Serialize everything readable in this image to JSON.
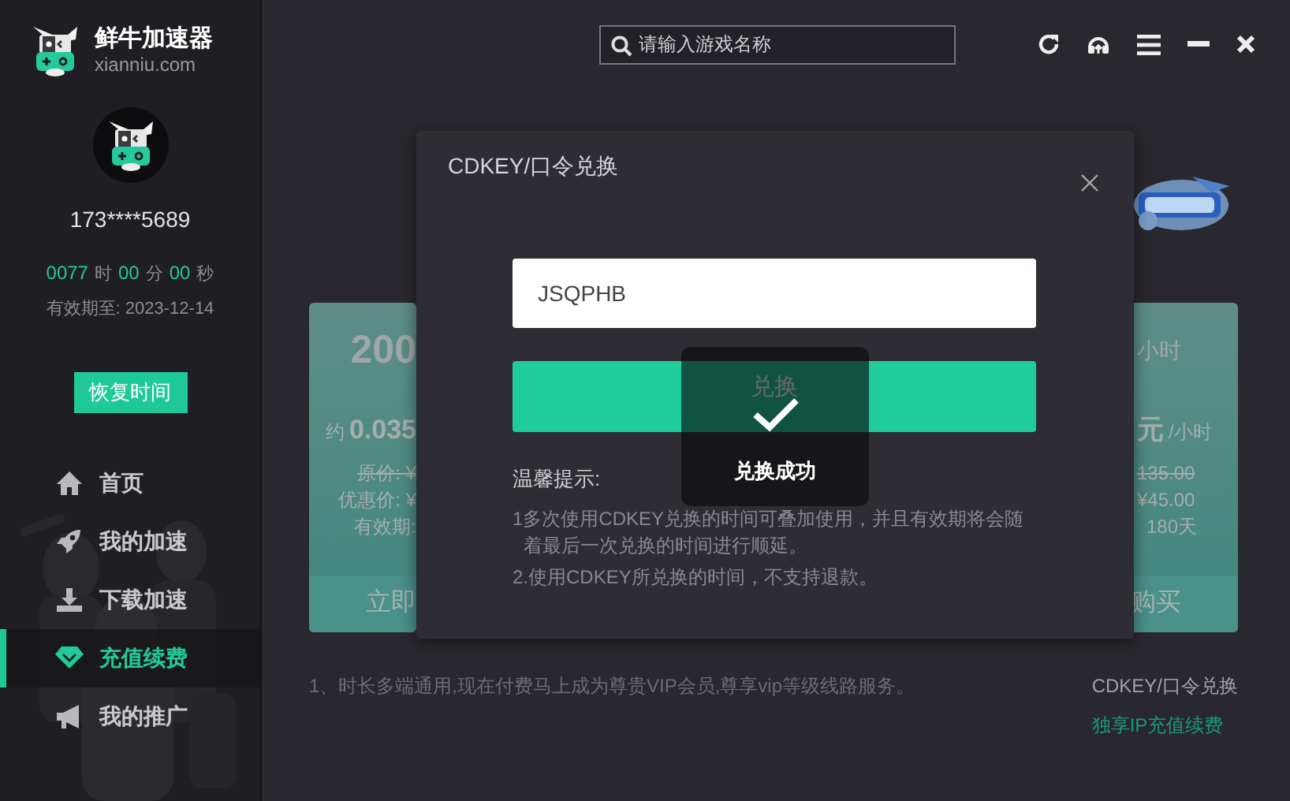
{
  "app": {
    "name": "鲜牛加速器",
    "domain": "xianniu.com"
  },
  "user": {
    "phone": "173****5689",
    "timer": [
      {
        "value": "0077",
        "unit": "时"
      },
      {
        "value": "00",
        "unit": "分"
      },
      {
        "value": "00",
        "unit": "秒"
      }
    ],
    "expiry": "有效期至: 2023-12-14",
    "restore_button": "恢复时间"
  },
  "nav": [
    {
      "label": "首页",
      "selected": false
    },
    {
      "label": "我的加速",
      "selected": false
    },
    {
      "label": "下载加速",
      "selected": false
    },
    {
      "label": "充值续费",
      "selected": true
    },
    {
      "label": "我的推广",
      "selected": false
    }
  ],
  "search": {
    "placeholder": "请输入游戏名称"
  },
  "plans": [
    {
      "amount": "200",
      "price_prefix": "约",
      "price": "0.035",
      "original": "原价: ¥",
      "discount": "优惠价: ¥",
      "validity": "有效期:",
      "buy": "立即"
    },
    {
      "amount_unit": "小时",
      "price": "元",
      "per": "/小时",
      "original": "135.00",
      "discount": "¥45.00",
      "validity": "180天",
      "buy": "购买"
    }
  ],
  "footer": {
    "note": "1、时长多端通用,现在付费马上成为尊贵VIP会员,尊享vip等级线路服务。",
    "links": [
      {
        "label": "CDKEY/口令兑换",
        "kind": "plain"
      },
      {
        "label": "独享IP充值续费",
        "kind": "accent"
      }
    ]
  },
  "modal": {
    "title": "CDKEY/口令兑换",
    "code": "JSQPHB",
    "submit": "兑换",
    "tips_title": "温馨提示:",
    "tips": [
      "1多次使用CDKEY兑换的时间可叠加使用，并且有效期将会随着最后一次兑换的时间进行顺延。",
      "2.使用CDKEY所兑换的时间，不支持退款。"
    ]
  },
  "toast": {
    "message": "兑换成功"
  }
}
